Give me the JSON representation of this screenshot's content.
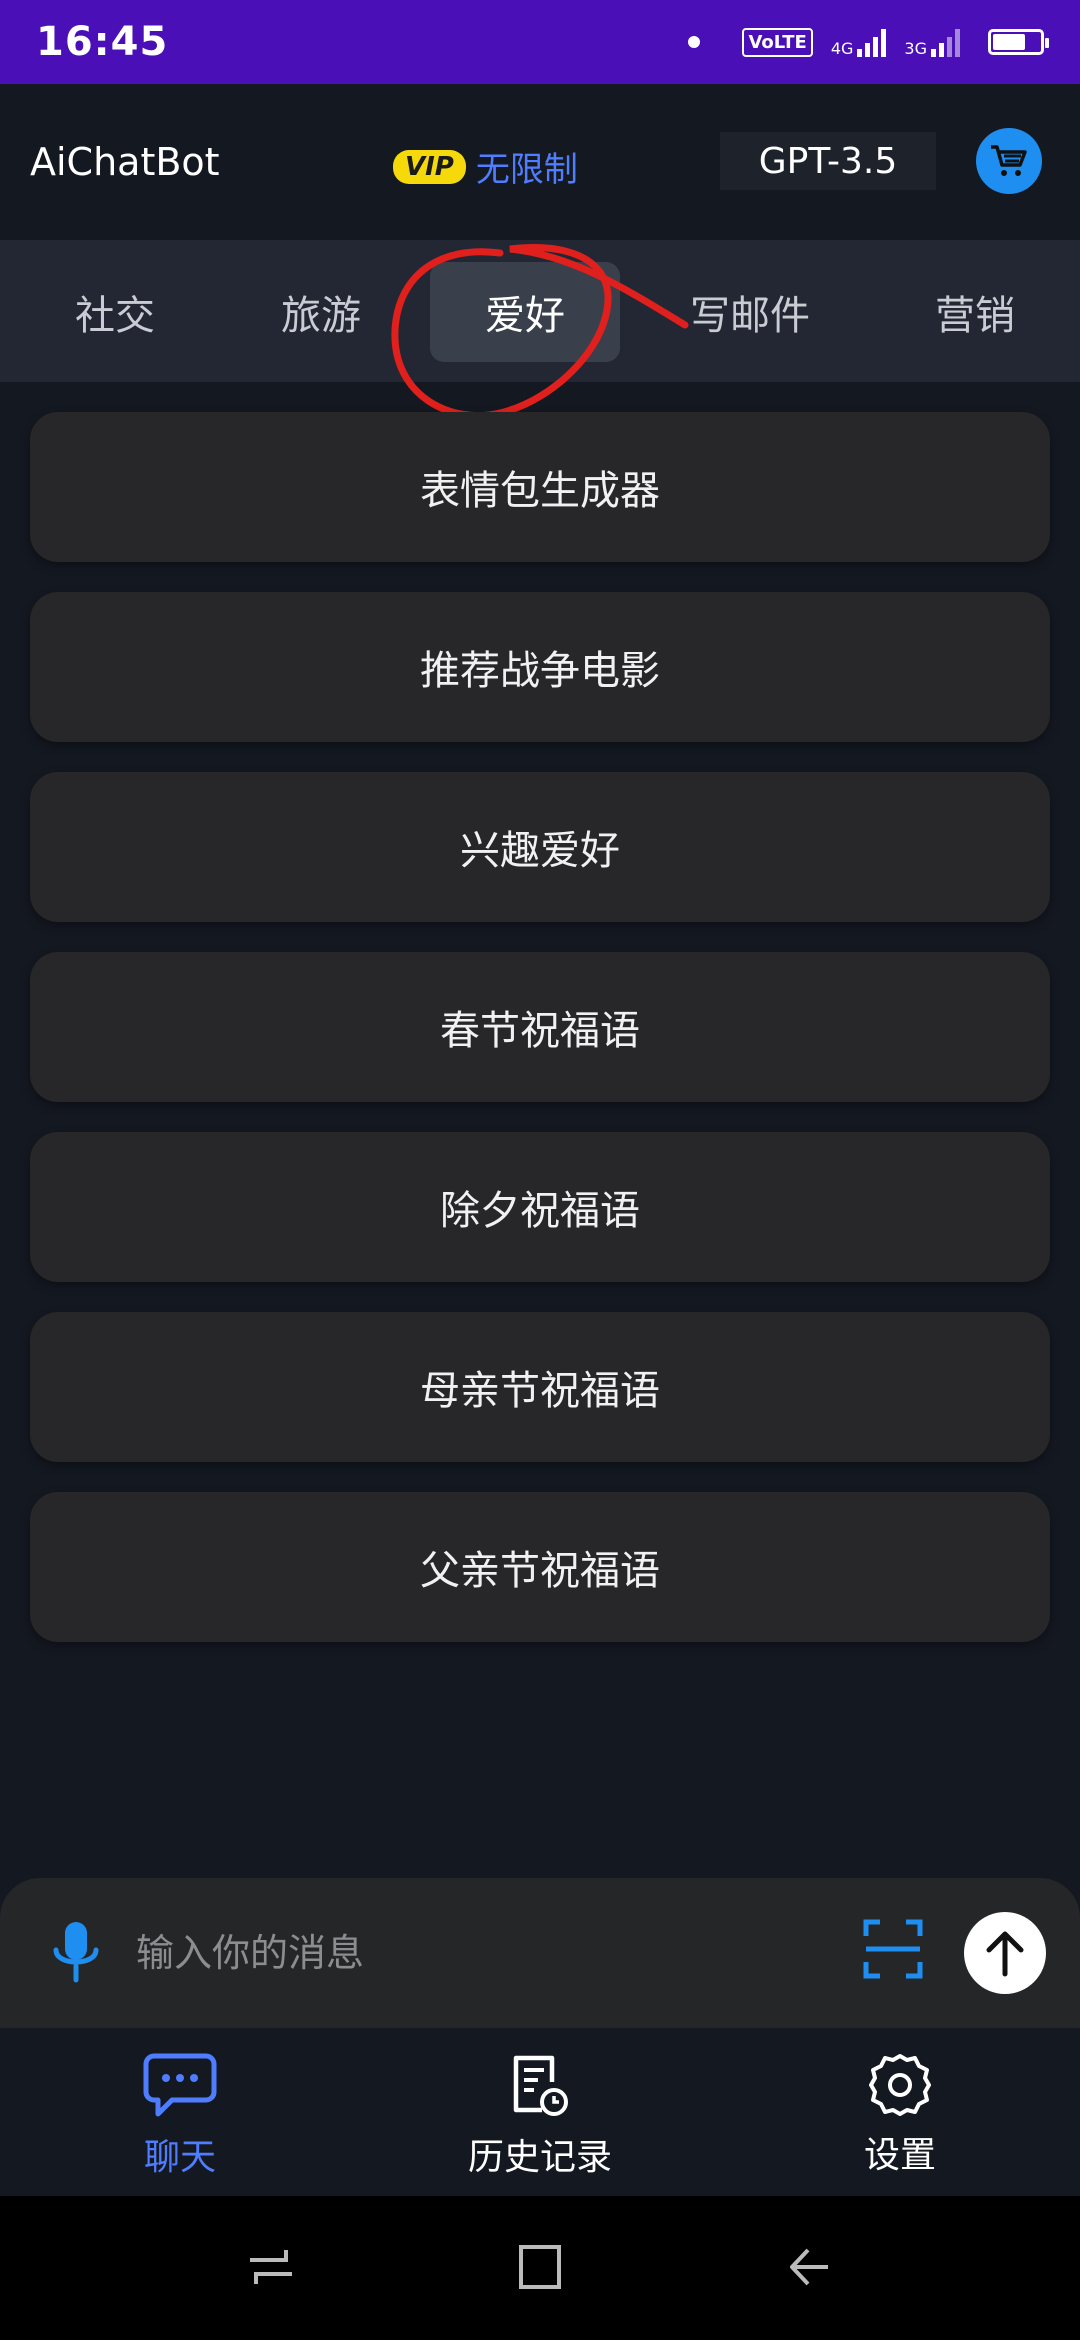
{
  "status_bar": {
    "time": "16:45",
    "volte": "VoLTE",
    "net1": "4G",
    "net2": "3G",
    "battery_level": 0.7
  },
  "header": {
    "app_title": "AiChatBot",
    "vip_badge": "VIP",
    "vip_text": "无限制",
    "model": "GPT-3.5",
    "cart_icon": "shopping-cart-icon"
  },
  "tabs": {
    "items": [
      "社交",
      "旅游",
      "爱好",
      "写邮件",
      "营销"
    ],
    "selected": "爱好"
  },
  "prompts": [
    "表情包生成器",
    "推荐战争电影",
    "兴趣爱好",
    "春节祝福语",
    "除夕祝福语",
    "母亲节祝福语",
    "父亲节祝福语"
  ],
  "input": {
    "placeholder": "输入你的消息"
  },
  "bottom_nav": {
    "chat": "聊天",
    "history": "历史记录",
    "settings": "设置",
    "active": "聊天"
  },
  "colors": {
    "status_bar": "#4a0fb6",
    "accent_blue": "#4f7dff",
    "vip_yellow": "#f5d90a",
    "annotation_red": "#e0201c",
    "background": "#141821"
  }
}
